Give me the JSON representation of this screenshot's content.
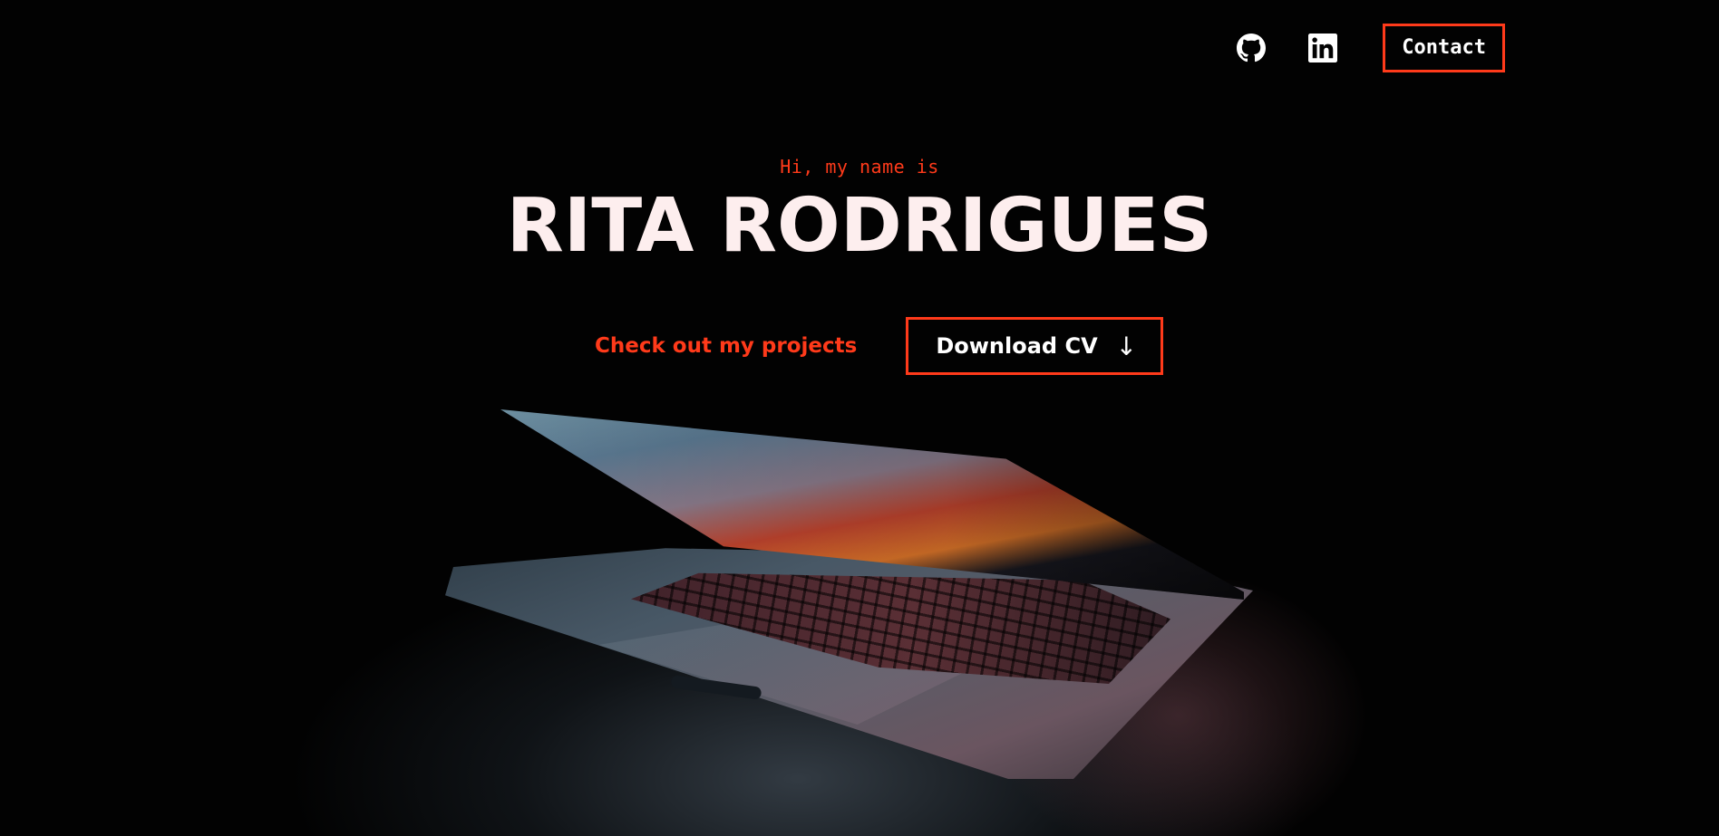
{
  "nav": {
    "github_icon": "github-icon",
    "linkedin_icon": "linkedin-icon",
    "contact_label": "Contact"
  },
  "intro": {
    "greeting": "Hi, my name is",
    "name": "RITA RODRIGUES"
  },
  "actions": {
    "projects_label": "Check out my projects",
    "download_label": "Download CV",
    "download_arrow": "↓"
  },
  "colors": {
    "accent": "#ff3a1a",
    "background": "#000000",
    "name_text": "#fdeeee"
  }
}
